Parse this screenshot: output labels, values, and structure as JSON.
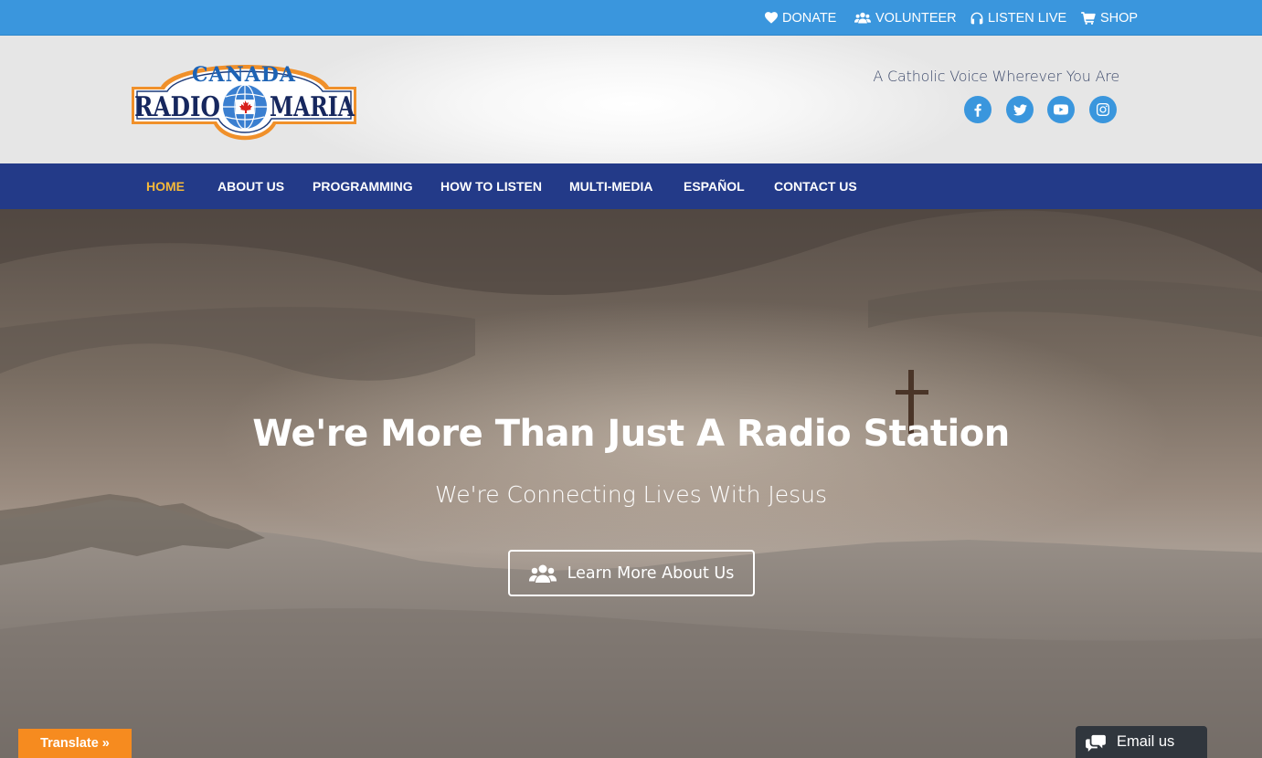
{
  "topbar": {
    "links": [
      {
        "label": "DONATE",
        "icon": "heart-icon"
      },
      {
        "label": "VOLUNTEER",
        "icon": "users-icon"
      },
      {
        "label": "LISTEN LIVE",
        "icon": "headphones-icon"
      },
      {
        "label": "SHOP",
        "icon": "shopping-cart-icon"
      }
    ]
  },
  "header": {
    "logo": {
      "top_text": "CANADA",
      "left_text": "RADIO",
      "right_text": "MARIA"
    },
    "tagline": "A Catholic Voice Wherever You Are",
    "social": [
      "facebook-icon",
      "twitter-icon",
      "youtube-icon",
      "instagram-icon"
    ]
  },
  "nav": {
    "items": [
      "HOME",
      "ABOUT US",
      "PROGRAMMING",
      "HOW TO LISTEN",
      "MULTI-MEDIA",
      "ESPAÑOL",
      "CONTACT US"
    ],
    "active": "HOME"
  },
  "hero": {
    "title": "We're More Than Just A Radio Station",
    "subtitle": "We're Connecting Lives With Jesus",
    "button_label": "Learn More About Us",
    "button_icon": "users-icon"
  },
  "widgets": {
    "translate_label": "Translate »",
    "email_label": "Email us",
    "email_icon": "chat-bubbles-icon"
  },
  "colors": {
    "topbar": "#3a96dd",
    "nav": "#233a88",
    "nav_active": "#f4b83a",
    "translate": "#f68b1f",
    "email_widget": "#30363d"
  }
}
